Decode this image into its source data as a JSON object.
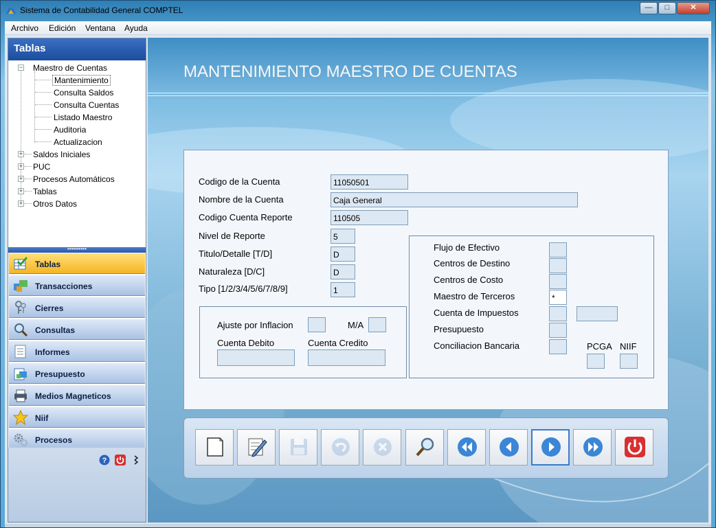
{
  "window": {
    "title": "Sistema de Contabilidad General COMPTEL",
    "controls": [
      "minimize",
      "maximize",
      "close"
    ]
  },
  "menu": {
    "items": [
      "Archivo",
      "Edición",
      "Ventana",
      "Ayuda"
    ]
  },
  "sidebar": {
    "header": "Tablas",
    "tree": [
      {
        "label": "Maestro de Cuentas",
        "expanded": true,
        "children": [
          "Mantenimiento",
          "Consulta Saldos",
          "Consulta Cuentas",
          "Listado Maestro",
          "Auditoria",
          "Actualizacion"
        ]
      },
      {
        "label": "Saldos Iniciales",
        "expanded": false
      },
      {
        "label": "PUC",
        "expanded": false
      },
      {
        "label": "Procesos Automáticos",
        "expanded": false
      },
      {
        "label": "Tablas",
        "expanded": false
      },
      {
        "label": "Otros Datos",
        "expanded": false
      }
    ],
    "selected_item": "Mantenimiento",
    "nav": [
      {
        "label": "Tablas",
        "icon": "table-check-icon",
        "active": true
      },
      {
        "label": "Transacciones",
        "icon": "transactions-icon"
      },
      {
        "label": "Cierres",
        "icon": "keys-icon"
      },
      {
        "label": "Consultas",
        "icon": "magnifier-icon"
      },
      {
        "label": "Informes",
        "icon": "report-icon"
      },
      {
        "label": "Presupuesto",
        "icon": "budget-icon"
      },
      {
        "label": "Medios Magneticos",
        "icon": "printer-icon"
      },
      {
        "label": "Niif",
        "icon": "star-icon"
      },
      {
        "label": "Procesos",
        "icon": "gears-icon"
      }
    ],
    "footer_icons": [
      "help-icon",
      "power-icon",
      "chevron-icon"
    ]
  },
  "main": {
    "title": "MANTENIMIENTO MAESTRO DE CUENTAS",
    "fields": {
      "codigo_cuenta": {
        "label": "Codigo de la Cuenta",
        "value": "11050501"
      },
      "nombre_cuenta": {
        "label": "Nombre de la Cuenta",
        "value": "Caja General"
      },
      "codigo_reporte": {
        "label": "Codigo Cuenta Reporte",
        "value": "110505"
      },
      "nivel_reporte": {
        "label": "Nivel de Reporte",
        "value": "5"
      },
      "titulo_detalle": {
        "label": "Titulo/Detalle [T/D]",
        "value": "D"
      },
      "naturaleza": {
        "label": "Naturaleza [D/C]",
        "value": "D"
      },
      "tipo": {
        "label": "Tipo  [1/2/3/4/5/6/7/8/9]",
        "value": "1"
      }
    },
    "ajuste": {
      "label": "Ajuste por Inflacion",
      "value": "",
      "ma_label": "M/A",
      "ma_value": "",
      "cuenta_debito_label": "Cuenta Debito",
      "cuenta_debito_value": "",
      "cuenta_credito_label": "Cuenta Credito",
      "cuenta_credito_value": ""
    },
    "flags": {
      "flujo_efectivo": {
        "label": "Flujo de Efectivo",
        "value": ""
      },
      "centros_destino": {
        "label": "Centros de Destino",
        "value": ""
      },
      "centros_costo": {
        "label": "Centros de Costo",
        "value": ""
      },
      "maestro_terceros": {
        "label": "Maestro de Terceros",
        "value": "*"
      },
      "cuenta_impuestos": {
        "label": "Cuenta de Impuestos",
        "value": "",
        "extra_value": ""
      },
      "presupuesto": {
        "label": "Presupuesto",
        "value": ""
      },
      "conciliacion": {
        "label": "Conciliacion Bancaria",
        "value": ""
      },
      "pcga": {
        "label": "PCGA",
        "value": ""
      },
      "niif": {
        "label": "NIIF",
        "value": ""
      }
    }
  },
  "toolbar": {
    "buttons": [
      {
        "name": "new-button",
        "icon": "new-page-icon",
        "enabled": true
      },
      {
        "name": "edit-button",
        "icon": "edit-icon",
        "enabled": true
      },
      {
        "name": "save-button",
        "icon": "floppy-icon",
        "enabled": false
      },
      {
        "name": "undo-button",
        "icon": "undo-icon",
        "enabled": false
      },
      {
        "name": "delete-button",
        "icon": "delete-icon",
        "enabled": false
      },
      {
        "name": "search-button",
        "icon": "magnifier-icon",
        "enabled": true
      },
      {
        "name": "first-button",
        "icon": "first-icon",
        "enabled": true
      },
      {
        "name": "prev-button",
        "icon": "prev-icon",
        "enabled": true
      },
      {
        "name": "next-button",
        "icon": "next-icon",
        "enabled": true,
        "focused": true
      },
      {
        "name": "last-button",
        "icon": "last-icon",
        "enabled": true
      },
      {
        "name": "exit-button",
        "icon": "power-icon",
        "enabled": true
      }
    ]
  },
  "colors": {
    "accent_blue": "#2a5aa8",
    "active_nav": "#f5b522",
    "form_bg": "#f3f7fb",
    "field_bg": "#dce8f3",
    "nav_arrow": "#3b86d6",
    "exit_red": "#d83030"
  }
}
